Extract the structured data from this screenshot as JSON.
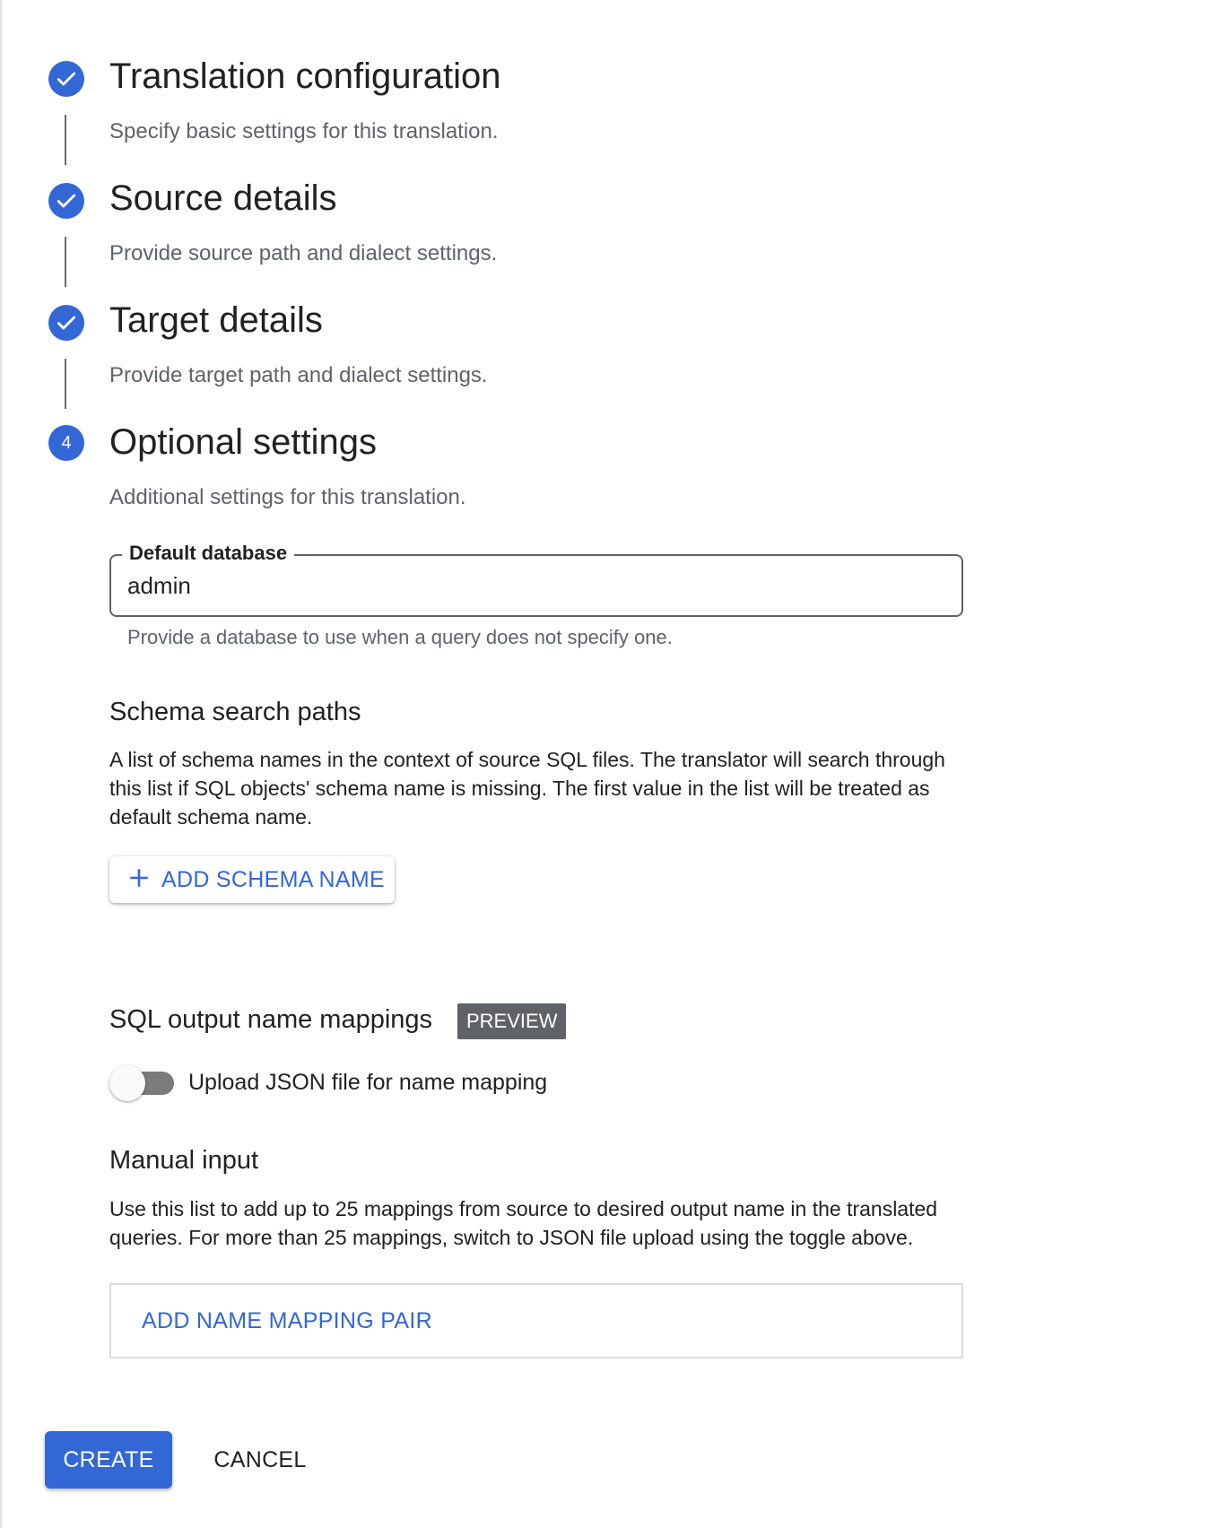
{
  "steps": [
    {
      "status": "completed",
      "icon": "check-icon",
      "title": "Translation configuration",
      "description": "Specify basic settings for this translation."
    },
    {
      "status": "completed",
      "icon": "check-icon",
      "title": "Source details",
      "description": "Provide source path and dialect settings."
    },
    {
      "status": "completed",
      "icon": "check-icon",
      "title": "Target details",
      "description": "Provide target path and dialect settings."
    },
    {
      "status": "active",
      "number": "4",
      "title": "Optional settings",
      "description": "Additional settings for this translation."
    }
  ],
  "default_database": {
    "label": "Default database",
    "value": "admin",
    "hint": "Provide a database to use when a query does not specify one."
  },
  "schema_search": {
    "title": "Schema search paths",
    "description": "A list of schema names in the context of source SQL files. The translator will search through this list if SQL objects' schema name is missing. The first value in the list will be treated as default schema name.",
    "add_button_label": "ADD SCHEMA NAME",
    "add_icon": "plus-icon"
  },
  "name_mappings": {
    "title": "SQL output name mappings",
    "badge": "PREVIEW",
    "toggle_label": "Upload JSON file for name mapping",
    "toggle_on": false,
    "manual_title": "Manual input",
    "manual_description": "Use this list to add up to 25 mappings from source to desired output name in the translated queries. For more than 25 mappings, switch to JSON file upload using the toggle above.",
    "add_pair_label": "ADD NAME MAPPING PAIR"
  },
  "actions": {
    "create_label": "CREATE",
    "cancel_label": "CANCEL"
  },
  "colors": {
    "accent": "#3367d6",
    "badge_bg": "#5f6368",
    "secondary_text": "#5f6368"
  }
}
